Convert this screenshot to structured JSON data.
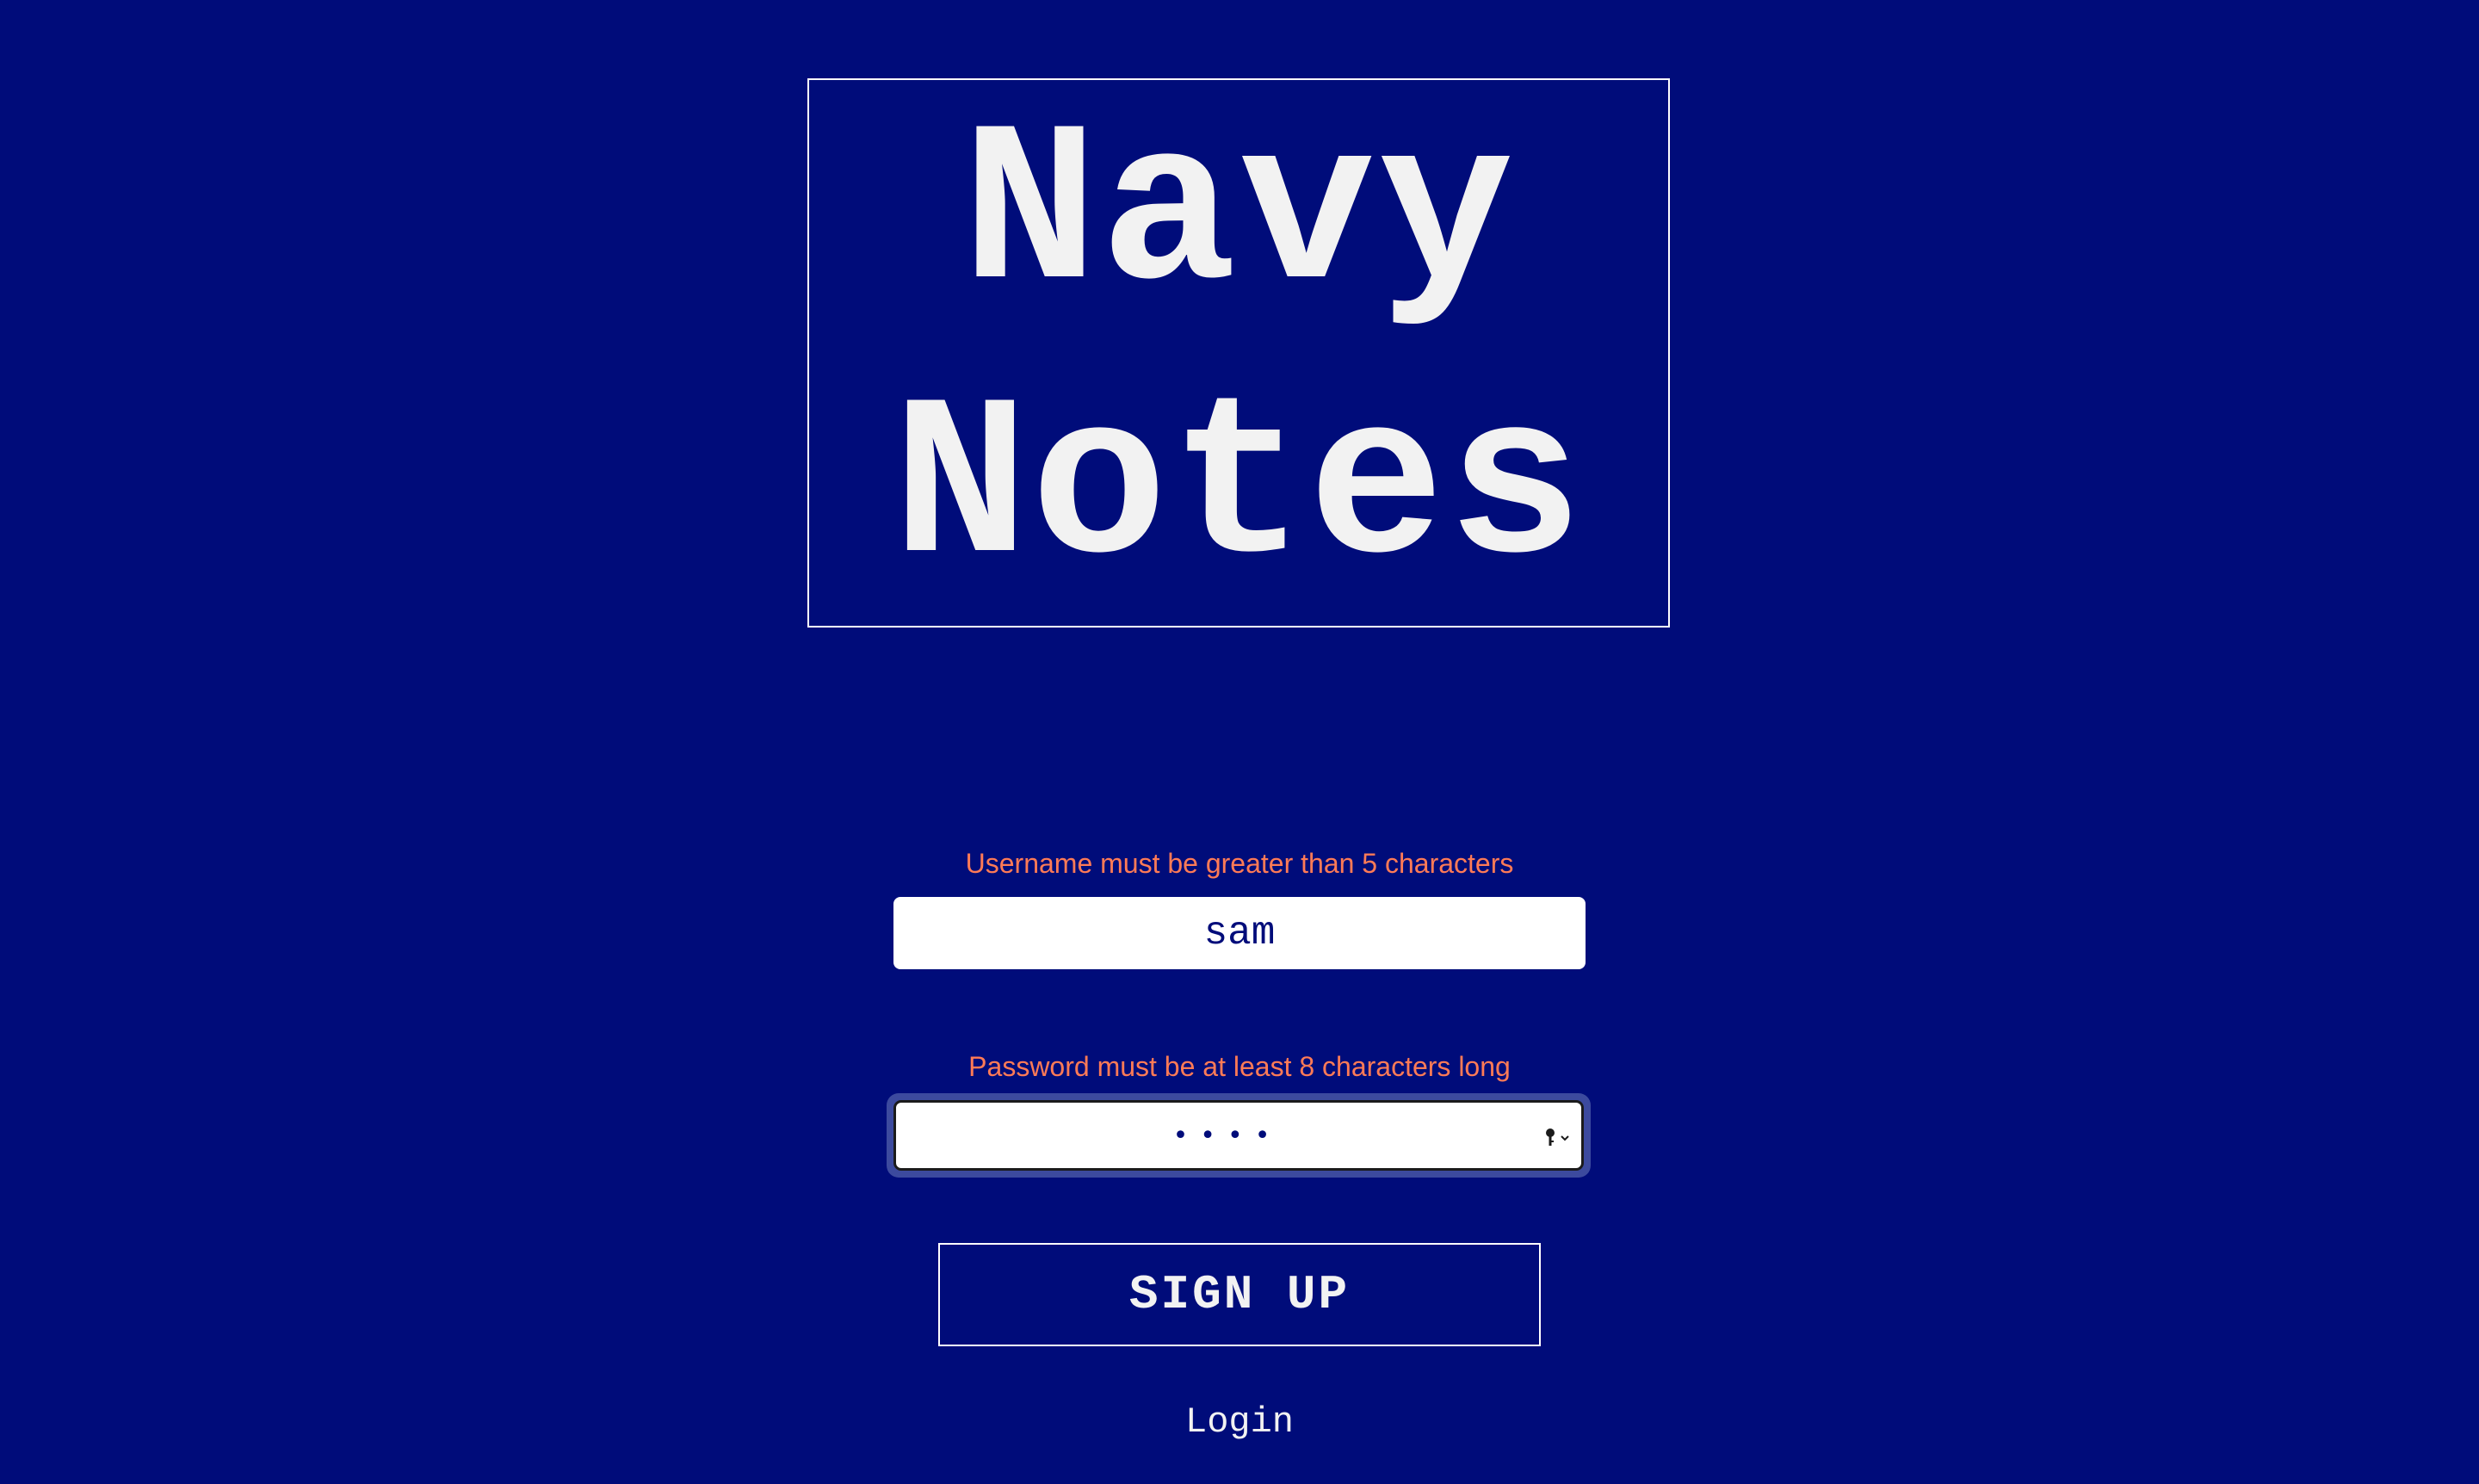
{
  "logo": {
    "line1": "Navy",
    "line2": "Notes"
  },
  "form": {
    "username_error": "Username must be greater than 5 characters",
    "username_value": "sam",
    "password_error": "Password must be at least 8 characters long",
    "password_masked": "••••",
    "password_icon": "key-icon",
    "signup_label": "SIGN UP",
    "login_label": "Login"
  },
  "colors": {
    "background": "#000c7a",
    "error": "#ff7b56",
    "text": "#f2f2f2",
    "input_text": "#000c7a"
  }
}
